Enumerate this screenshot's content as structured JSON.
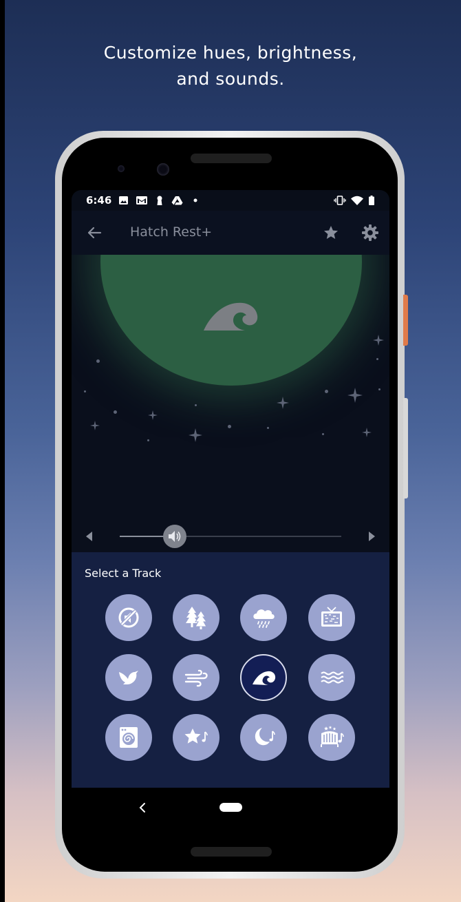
{
  "caption": {
    "line1": "Customize hues, brightness,",
    "line2": "and sounds."
  },
  "status_bar": {
    "time": "6:46",
    "left_icons": [
      "image-icon",
      "gmail-icon",
      "keyhole-icon",
      "drive-icon",
      "dot-icon"
    ],
    "right_icons": [
      "vibrate-icon",
      "wifi-icon",
      "battery-icon"
    ]
  },
  "app_bar": {
    "title": "Hatch Rest+",
    "back_icon": "arrow-left-icon",
    "favorite_icon": "star-icon",
    "settings_icon": "gear-icon"
  },
  "hero": {
    "light_color": "#2c5f43",
    "sound_icon": "ocean-wave-icon"
  },
  "volume": {
    "level": 0.25,
    "icon": "speaker-icon"
  },
  "track_panel": {
    "title": "Select a Track",
    "tracks": [
      {
        "name": "no-sound",
        "icon": "mute-icon",
        "selected": false
      },
      {
        "name": "forest",
        "icon": "trees-icon",
        "selected": false
      },
      {
        "name": "rain",
        "icon": "rain-cloud-icon",
        "selected": false
      },
      {
        "name": "white-noise",
        "icon": "tv-static-icon",
        "selected": false
      },
      {
        "name": "birds",
        "icon": "bird-icon",
        "selected": false
      },
      {
        "name": "wind",
        "icon": "wind-icon",
        "selected": false
      },
      {
        "name": "ocean",
        "icon": "ocean-wave-icon",
        "selected": true
      },
      {
        "name": "water",
        "icon": "water-waves-icon",
        "selected": false
      },
      {
        "name": "dryer",
        "icon": "dryer-icon",
        "selected": false
      },
      {
        "name": "twinkle",
        "icon": "star-music-icon",
        "selected": false
      },
      {
        "name": "lullaby",
        "icon": "moon-music-icon",
        "selected": false
      },
      {
        "name": "crib",
        "icon": "crib-music-icon",
        "selected": false
      }
    ]
  },
  "colors": {
    "accent": "#9aa3cf",
    "panel": "#152042",
    "selected": "#131e55"
  }
}
